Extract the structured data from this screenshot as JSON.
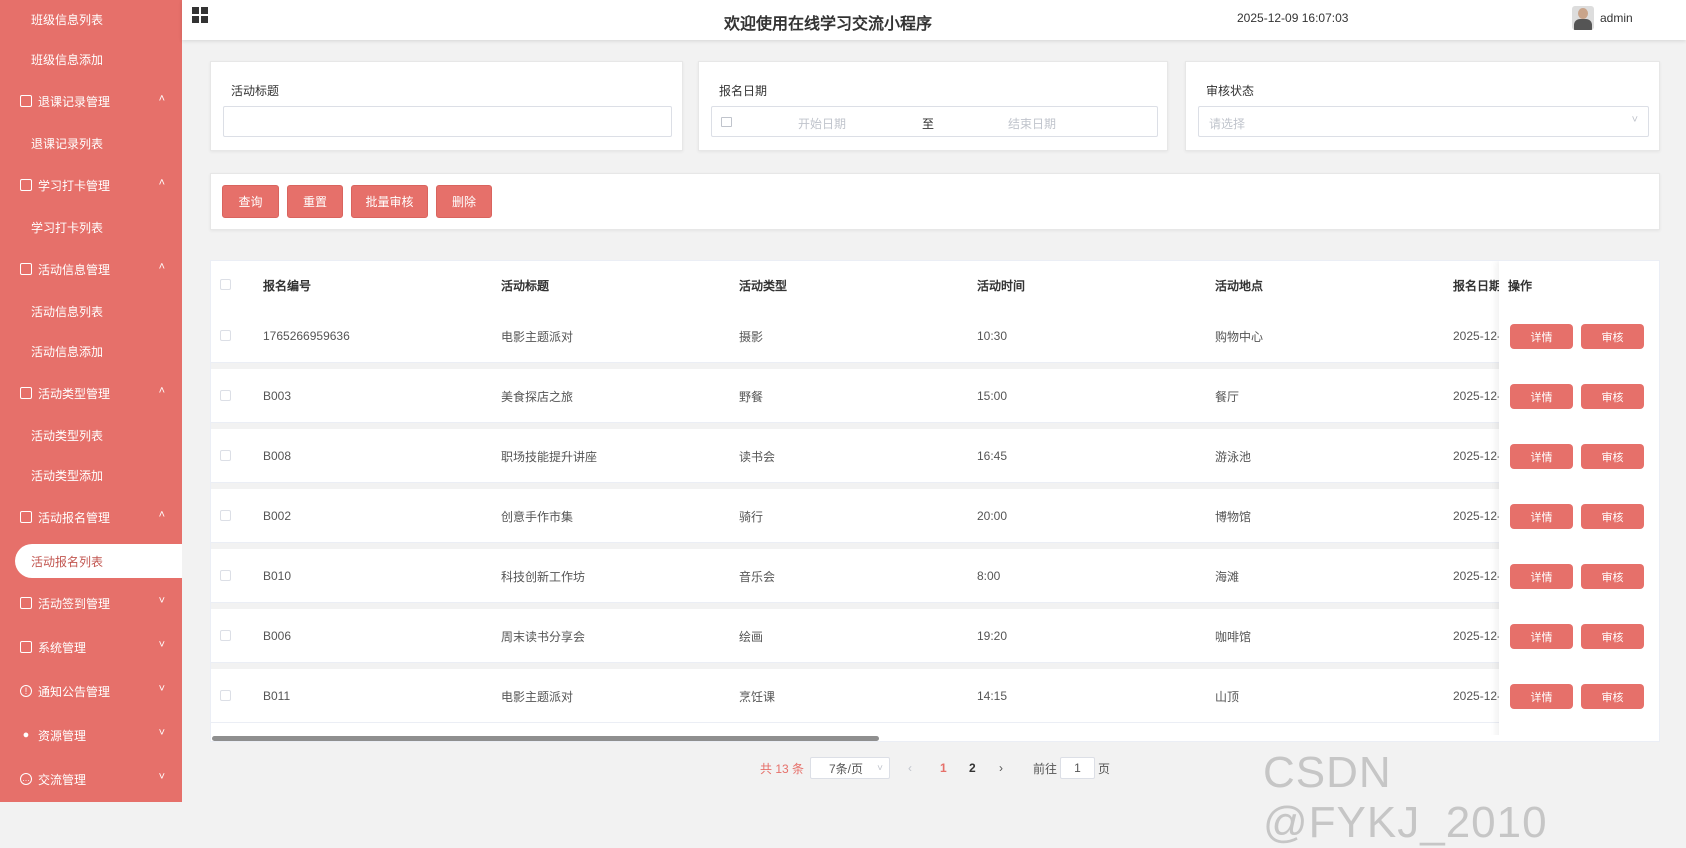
{
  "sidebar": {
    "items": [
      {
        "label": "班级信息列表"
      },
      {
        "label": "班级信息添加"
      },
      {
        "label": "退课记录管理"
      },
      {
        "label": "退课记录列表"
      },
      {
        "label": "学习打卡管理"
      },
      {
        "label": "学习打卡列表"
      },
      {
        "label": "活动信息管理"
      },
      {
        "label": "活动信息列表"
      },
      {
        "label": "活动信息添加"
      },
      {
        "label": "活动类型管理"
      },
      {
        "label": "活动类型列表"
      },
      {
        "label": "活动类型添加"
      },
      {
        "label": "活动报名管理"
      },
      {
        "label": "活动报名列表"
      },
      {
        "label": "活动签到管理"
      },
      {
        "label": "系统管理"
      },
      {
        "label": "通知公告管理"
      },
      {
        "label": "资源管理"
      },
      {
        "label": "交流管理"
      }
    ],
    "active": "活动报名列表"
  },
  "header": {
    "title": "欢迎使用在线学习交流小程序",
    "datetime": "2025-12-09 16:07:03",
    "username": "admin"
  },
  "filters": {
    "title_label": "活动标题",
    "title_value": "",
    "date_label": "报名日期",
    "date_start_placeholder": "开始日期",
    "date_separator": "至",
    "date_end_placeholder": "结束日期",
    "status_label": "审核状态",
    "status_placeholder": "请选择"
  },
  "actions": {
    "query": "查询",
    "reset": "重置",
    "batch_review": "批量审核",
    "delete": "删除"
  },
  "table": {
    "columns": [
      "报名编号",
      "活动标题",
      "活动类型",
      "活动时间",
      "活动地点",
      "报名日期",
      "操作"
    ],
    "rows": [
      {
        "id": "1765266959636",
        "title": "电影主题派对",
        "type": "摄影",
        "time": "10:30",
        "place": "购物中心",
        "date": "2025-12-"
      },
      {
        "id": "B003",
        "title": "美食探店之旅",
        "type": "野餐",
        "time": "15:00",
        "place": "餐厅",
        "date": "2025-12-"
      },
      {
        "id": "B008",
        "title": "职场技能提升讲座",
        "type": "读书会",
        "time": "16:45",
        "place": "游泳池",
        "date": "2025-12-"
      },
      {
        "id": "B002",
        "title": "创意手作市集",
        "type": "骑行",
        "time": "20:00",
        "place": "博物馆",
        "date": "2025-12-"
      },
      {
        "id": "B010",
        "title": "科技创新工作坊",
        "type": "音乐会",
        "time": "8:00",
        "place": "海滩",
        "date": "2025-12-"
      },
      {
        "id": "B006",
        "title": "周末读书分享会",
        "type": "绘画",
        "time": "19:20",
        "place": "咖啡馆",
        "date": "2025-12-"
      },
      {
        "id": "B011",
        "title": "电影主题派对",
        "type": "烹饪课",
        "time": "14:15",
        "place": "山顶",
        "date": "2025-12-"
      }
    ],
    "detail_label": "详情",
    "review_label": "审核"
  },
  "pagination": {
    "total": "共 13 条",
    "page_size": "7条/页",
    "pages": [
      "1",
      "2"
    ],
    "current": "1",
    "goto_label": "前往",
    "goto_value": "1",
    "page_suffix": "页",
    "prev": "‹",
    "next": "›"
  },
  "watermark": "CSDN @FYKJ_2010",
  "colors": {
    "accent": "#e6706a",
    "background": "#f2f2f2"
  },
  "icons": {
    "menu": "grid-icon",
    "parent_items": "file-icon",
    "chevron": "chevron-icon"
  }
}
